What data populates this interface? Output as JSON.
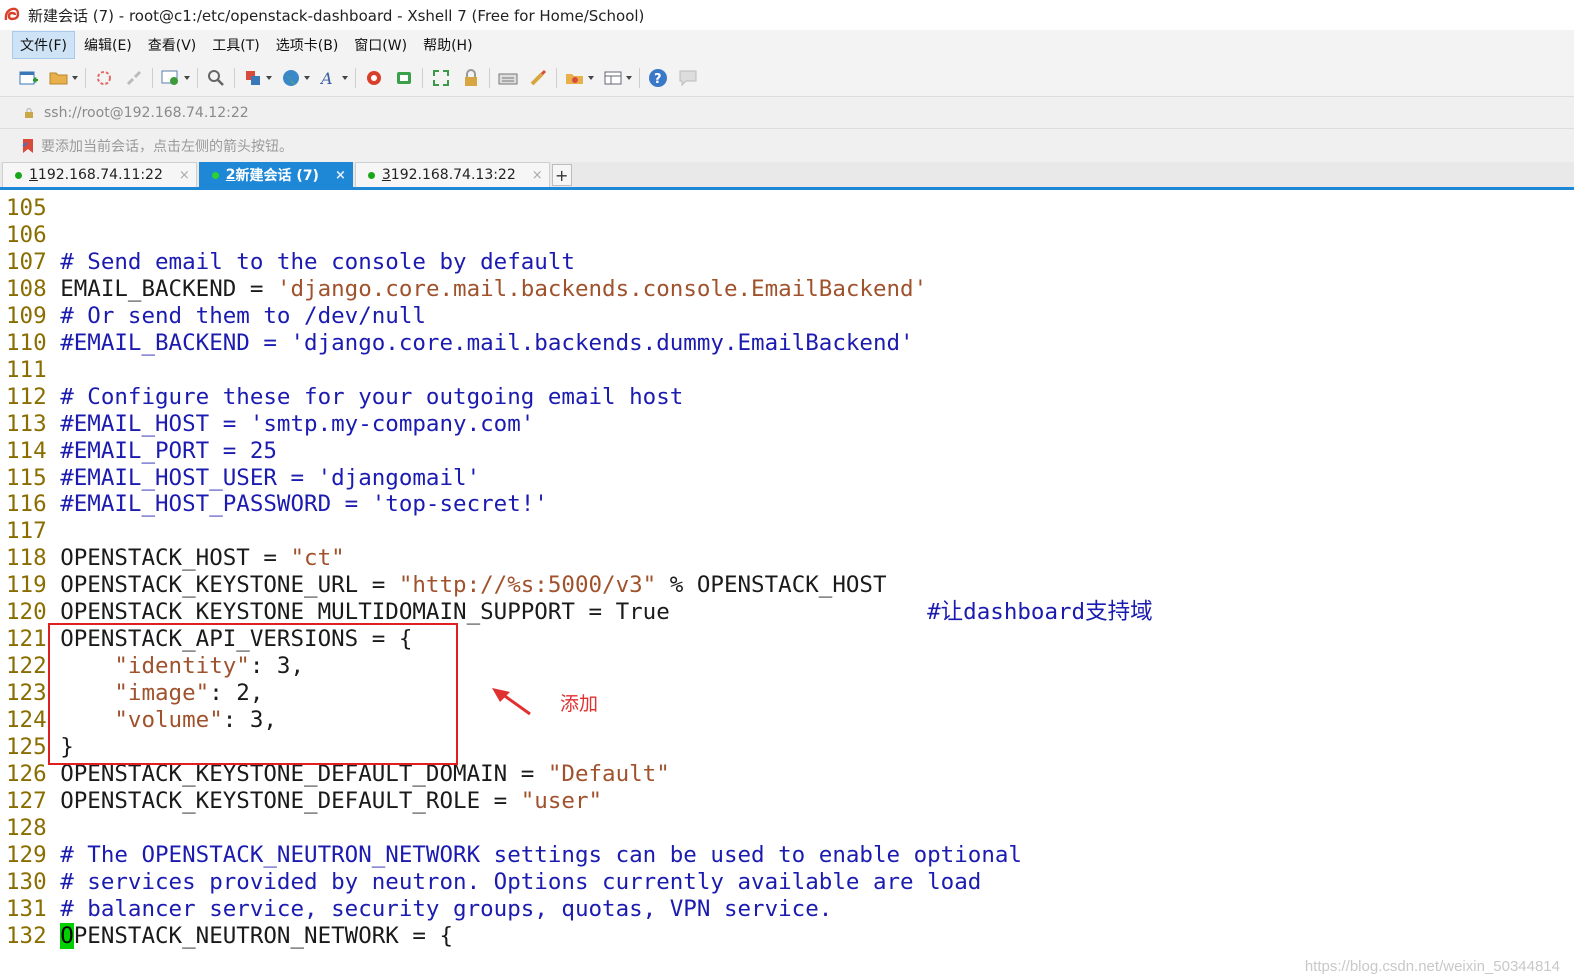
{
  "window": {
    "title": "新建会话 (7) - root@c1:/etc/openstack-dashboard - Xshell 7 (Free for Home/School)"
  },
  "menu": [
    "文件(F)",
    "编辑(E)",
    "查看(V)",
    "工具(T)",
    "选项卡(B)",
    "窗口(W)",
    "帮助(H)"
  ],
  "address": "ssh://root@192.168.74.12:22",
  "hint": "要添加当前会话，点击左侧的箭头按钮。",
  "tabs": [
    {
      "num": "1",
      "label": " 192.168.74.11:22",
      "close": "×"
    },
    {
      "num": "2",
      "label": " 新建会话 (7)",
      "close": "×"
    },
    {
      "num": "3",
      "label": " 192.168.74.13:22",
      "close": "×"
    }
  ],
  "tab_add": "+",
  "lines": [
    {
      "n": "105",
      "parts": []
    },
    {
      "n": "106",
      "parts": []
    },
    {
      "n": "107",
      "parts": [
        [
          "c",
          "# Send email to the console by default"
        ]
      ]
    },
    {
      "n": "108",
      "parts": [
        [
          "p",
          "EMAIL_BACKEND = "
        ],
        [
          "s",
          "'django.core.mail.backends.console.EmailBackend'"
        ]
      ]
    },
    {
      "n": "109",
      "parts": [
        [
          "c",
          "# Or send them to /dev/null"
        ]
      ]
    },
    {
      "n": "110",
      "parts": [
        [
          "c",
          "#EMAIL_BACKEND = 'django.core.mail.backends.dummy.EmailBackend'"
        ]
      ]
    },
    {
      "n": "111",
      "parts": []
    },
    {
      "n": "112",
      "parts": [
        [
          "c",
          "# Configure these for your outgoing email host"
        ]
      ]
    },
    {
      "n": "113",
      "parts": [
        [
          "c",
          "#EMAIL_HOST = 'smtp.my-company.com'"
        ]
      ]
    },
    {
      "n": "114",
      "parts": [
        [
          "c",
          "#EMAIL_PORT = 25"
        ]
      ]
    },
    {
      "n": "115",
      "parts": [
        [
          "c",
          "#EMAIL_HOST_USER = 'djangomail'"
        ]
      ]
    },
    {
      "n": "116",
      "parts": [
        [
          "c",
          "#EMAIL_HOST_PASSWORD = 'top-secret!'"
        ]
      ]
    },
    {
      "n": "117",
      "parts": []
    },
    {
      "n": "118",
      "parts": [
        [
          "p",
          "OPENSTACK_HOST = "
        ],
        [
          "s",
          "\"ct\""
        ]
      ]
    },
    {
      "n": "119",
      "parts": [
        [
          "p",
          "OPENSTACK_KEYSTONE_URL = "
        ],
        [
          "s",
          "\"http://%s:5000/v3\""
        ],
        [
          "p",
          " % OPENSTACK_HOST"
        ]
      ]
    },
    {
      "n": "120",
      "parts": [
        [
          "p",
          "OPENSTACK_KEYSTONE_MULTIDOMAIN_SUPPORT = True                   "
        ],
        [
          "c",
          "#让dashboard支持域"
        ]
      ]
    },
    {
      "n": "121",
      "parts": [
        [
          "p",
          "OPENSTACK_API_VERSIONS = {"
        ]
      ]
    },
    {
      "n": "122",
      "parts": [
        [
          "p",
          "    "
        ],
        [
          "s",
          "\"identity\""
        ],
        [
          "p",
          ": 3,"
        ]
      ]
    },
    {
      "n": "123",
      "parts": [
        [
          "p",
          "    "
        ],
        [
          "s",
          "\"image\""
        ],
        [
          "p",
          ": 2,"
        ]
      ]
    },
    {
      "n": "124",
      "parts": [
        [
          "p",
          "    "
        ],
        [
          "s",
          "\"volume\""
        ],
        [
          "p",
          ": 3,"
        ]
      ]
    },
    {
      "n": "125",
      "parts": [
        [
          "p",
          "}"
        ]
      ]
    },
    {
      "n": "126",
      "parts": [
        [
          "p",
          "OPENSTACK_KEYSTONE_DEFAULT_DOMAIN = "
        ],
        [
          "s",
          "\"Default\""
        ]
      ]
    },
    {
      "n": "127",
      "parts": [
        [
          "p",
          "OPENSTACK_KEYSTONE_DEFAULT_ROLE = "
        ],
        [
          "s",
          "\"user\""
        ]
      ]
    },
    {
      "n": "128",
      "parts": []
    },
    {
      "n": "129",
      "parts": [
        [
          "c",
          "# The OPENSTACK_NEUTRON_NETWORK settings can be used to enable optional"
        ]
      ]
    },
    {
      "n": "130",
      "parts": [
        [
          "c",
          "# services provided by neutron. Options currently available are load"
        ]
      ]
    },
    {
      "n": "131",
      "parts": [
        [
          "c",
          "# balancer service, security groups, quotas, VPN service."
        ]
      ]
    },
    {
      "n": "132",
      "parts": [
        [
          "k",
          "O"
        ],
        [
          "p",
          "PENSTACK_NEUTRON_NETWORK = {"
        ]
      ]
    }
  ],
  "annotation": "添加",
  "watermark": "https://blog.csdn.net/weixin_50344814",
  "colors": {
    "tab_active": "#1f88d6",
    "line_number": "#8a6d00",
    "comment": "#1b1bb0",
    "string": "#a0522d",
    "cursor": "#00d000",
    "highlight_box": "#e02020"
  }
}
